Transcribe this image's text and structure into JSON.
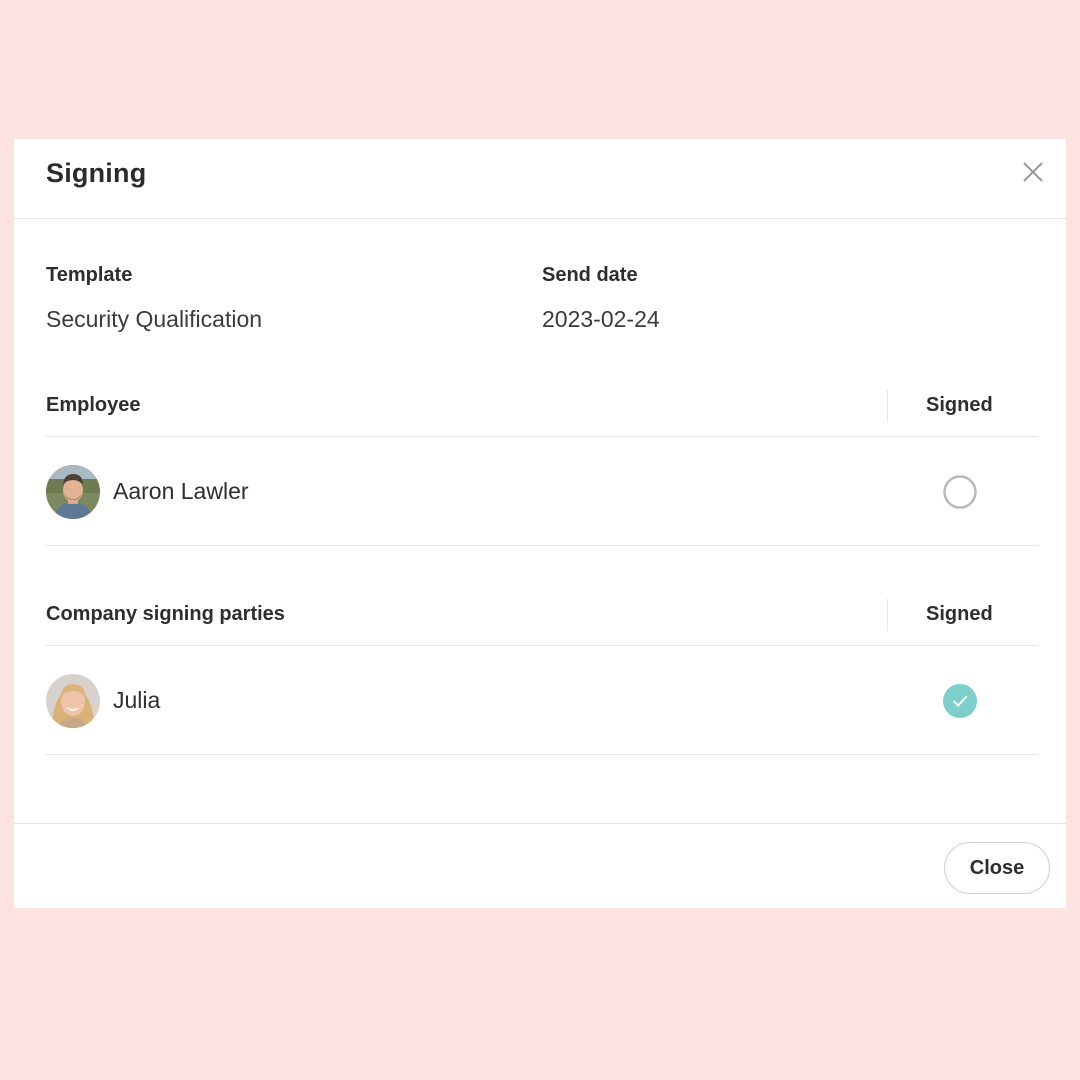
{
  "dialog": {
    "title": "Signing",
    "close_icon": "close-icon"
  },
  "details": {
    "template_label": "Template",
    "template_value": "Security Qualification",
    "send_date_label": "Send date",
    "send_date_value": "2023-02-24"
  },
  "employee_section": {
    "header": "Employee",
    "signed_header": "Signed",
    "rows": [
      {
        "name": "Aaron Lawler",
        "signed": false,
        "status_icon": "unsigned-circle-icon"
      }
    ]
  },
  "company_section": {
    "header": "Company signing parties",
    "signed_header": "Signed",
    "rows": [
      {
        "name": "Julia",
        "signed": true,
        "status_icon": "signed-check-icon"
      }
    ]
  },
  "footer": {
    "close_label": "Close"
  },
  "colors": {
    "background": "#fde2e2",
    "signed_accent": "#7ccfcb",
    "unsigned_ring": "#b9b9b9"
  }
}
